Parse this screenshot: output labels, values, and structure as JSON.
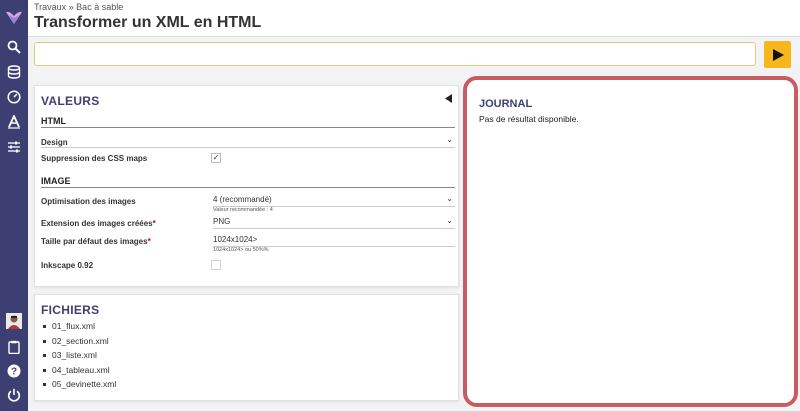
{
  "header": {
    "breadcrumb": "Travaux » Bac à sable",
    "title": "Transformer un XML en HTML"
  },
  "command": {
    "value": "",
    "run_icon": "play-icon"
  },
  "values_panel": {
    "title": "Valeurs",
    "collapse_icon": "caret-left-icon",
    "html_section": {
      "heading": "HTML",
      "design_label": "Design",
      "design_value": "",
      "css_maps_label": "Suppression des CSS maps",
      "css_maps_checked": true,
      "css_maps_mark": "✓"
    },
    "image_section": {
      "heading": "Image",
      "optim_label": "Optimisation des images",
      "optim_value": "4 (recommandé)",
      "optim_hint": "Valeur recommandée : 4",
      "ext_label": "Extension des images créées",
      "ext_value": "PNG",
      "size_label": "Taille par défaut des images",
      "size_value": "1024x1024>",
      "size_hint": "1024x1024> ou 50%%",
      "inkscape_label": "Inkscape 0.92",
      "inkscape_checked": false,
      "required_mark": "*"
    }
  },
  "files_panel": {
    "title": "Fichiers",
    "files": [
      "01_flux.xml",
      "02_section.xml",
      "03_liste.xml",
      "04_tableau.xml",
      "05_devinette.xml"
    ]
  },
  "journal": {
    "title": "Journal",
    "message": "Pas de résultat disponible."
  },
  "colors": {
    "sidebar": "#3d3f73",
    "accent": "#f7b61b",
    "highlight": "#c75c63",
    "panel_title": "#3d3f73"
  },
  "sidebar_icons": [
    "logo-icon",
    "search-icon",
    "database-icon",
    "dashboard-icon",
    "text-tool-icon",
    "sliders-icon",
    "user-avatar",
    "clipboard-icon",
    "help-icon",
    "power-icon"
  ]
}
